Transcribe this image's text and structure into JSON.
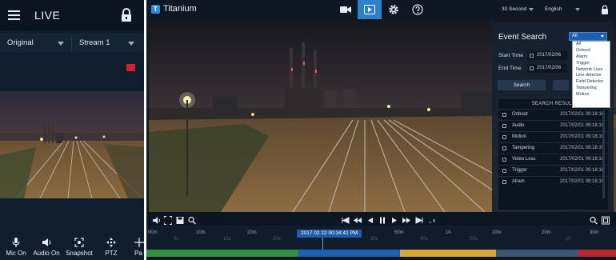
{
  "mobile": {
    "title": "LIVE",
    "select_quality": "Original",
    "select_stream": "Stream 1",
    "toolbar": [
      {
        "label": "Mic On",
        "icon": "mic-icon"
      },
      {
        "label": "Audio On",
        "icon": "speaker-icon"
      },
      {
        "label": "Snapshot",
        "icon": "snapshot-icon"
      },
      {
        "label": "PTZ",
        "icon": "ptz-icon"
      },
      {
        "label": "Pa",
        "icon": "preset-icon"
      }
    ]
  },
  "desktop": {
    "brand": "Titanium",
    "logo_letter": "T",
    "interval": "30 Second",
    "language": "English",
    "event_search": {
      "title": "Event Search",
      "filter_value": "All",
      "filter_options": [
        "All",
        "Onboot",
        "Alarm",
        "Trigger",
        "Network Loss",
        "Line detector",
        "Field Detector",
        "Tampering",
        "Motion"
      ],
      "start_time_label": "Start Time",
      "start_time_value": "2017/02/06",
      "end_time_label": "End Time",
      "end_time_value": "2017/02/06",
      "search_label": "Search",
      "result_header": "SEARCH RESULT",
      "results": [
        {
          "type": "Onboot",
          "time": "2017/02/01 09:18:16"
        },
        {
          "type": "Audio",
          "time": "2017/02/01 09:18:16"
        },
        {
          "type": "Motion",
          "time": "2017/02/01 09:18:16"
        },
        {
          "type": "Tampering",
          "time": "2017/02/01 09:18:16"
        },
        {
          "type": "Video Loss",
          "time": "2017/02/01 09:18:16"
        },
        {
          "type": "Trigger",
          "time": "2017/02/01 09:18:16"
        },
        {
          "type": "Alram",
          "time": "2017/02/01 09:18:16"
        }
      ]
    },
    "timeline": {
      "current_time": "2017 02 22 00:34:42 PM",
      "top_ticks": [
        "00m",
        "10m",
        "20m",
        "30m",
        "40m",
        "50m",
        "1h",
        "10m",
        "20m",
        "30m"
      ],
      "bottom_ticks": [
        "0s",
        "10s",
        "20s",
        "30s",
        "40s",
        "50s",
        "1h"
      ],
      "segment_colors": [
        "#2f8f3e",
        "#1d5fb0",
        "#d7a53a",
        "#3d5570",
        "#b8282c"
      ]
    }
  }
}
